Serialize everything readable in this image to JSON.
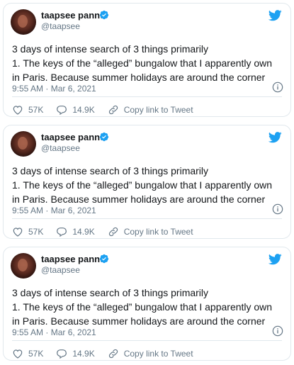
{
  "tweets": [
    {
      "name": "taapsee pannu",
      "handle": "@taapsee",
      "text_line1": "3 days of intense search of 3 things primarily",
      "text_line2": "1. The keys of the “alleged” bungalow that I apparently own",
      "text_line3": "in Paris. Because summer holidays are around the corner",
      "timestamp": "9:55 AM · Mar 6, 2021",
      "likes": "57K",
      "replies": "14.9K",
      "copy_link": "Copy link to Tweet"
    },
    {
      "name": "taapsee pannu",
      "handle": "@taapsee",
      "text_line1": "3 days of intense search of 3 things primarily",
      "text_line2": "1. The keys of the “alleged” bungalow that I apparently own",
      "text_line3": "in Paris. Because summer holidays are around the corner",
      "timestamp": "9:55 AM · Mar 6, 2021",
      "likes": "57K",
      "replies": "14.9K",
      "copy_link": "Copy link to Tweet"
    },
    {
      "name": "taapsee pannu",
      "handle": "@taapsee",
      "text_line1": "3 days of intense search of 3 things primarily",
      "text_line2": "1. The keys of the “alleged” bungalow that I apparently own",
      "text_line3": "in Paris. Because summer holidays are around the corner",
      "timestamp": "9:55 AM · Mar 6, 2021",
      "likes": "57K",
      "replies": "14.9K",
      "copy_link": "Copy link to Tweet"
    }
  ],
  "colors": {
    "twitter_blue": "#1da1f2",
    "text": "#14171a",
    "muted": "#657786",
    "border": "#e1e8ed"
  },
  "icons": [
    "verified-badge-icon",
    "twitter-bird-icon",
    "info-icon",
    "heart-icon",
    "reply-icon",
    "link-icon"
  ]
}
